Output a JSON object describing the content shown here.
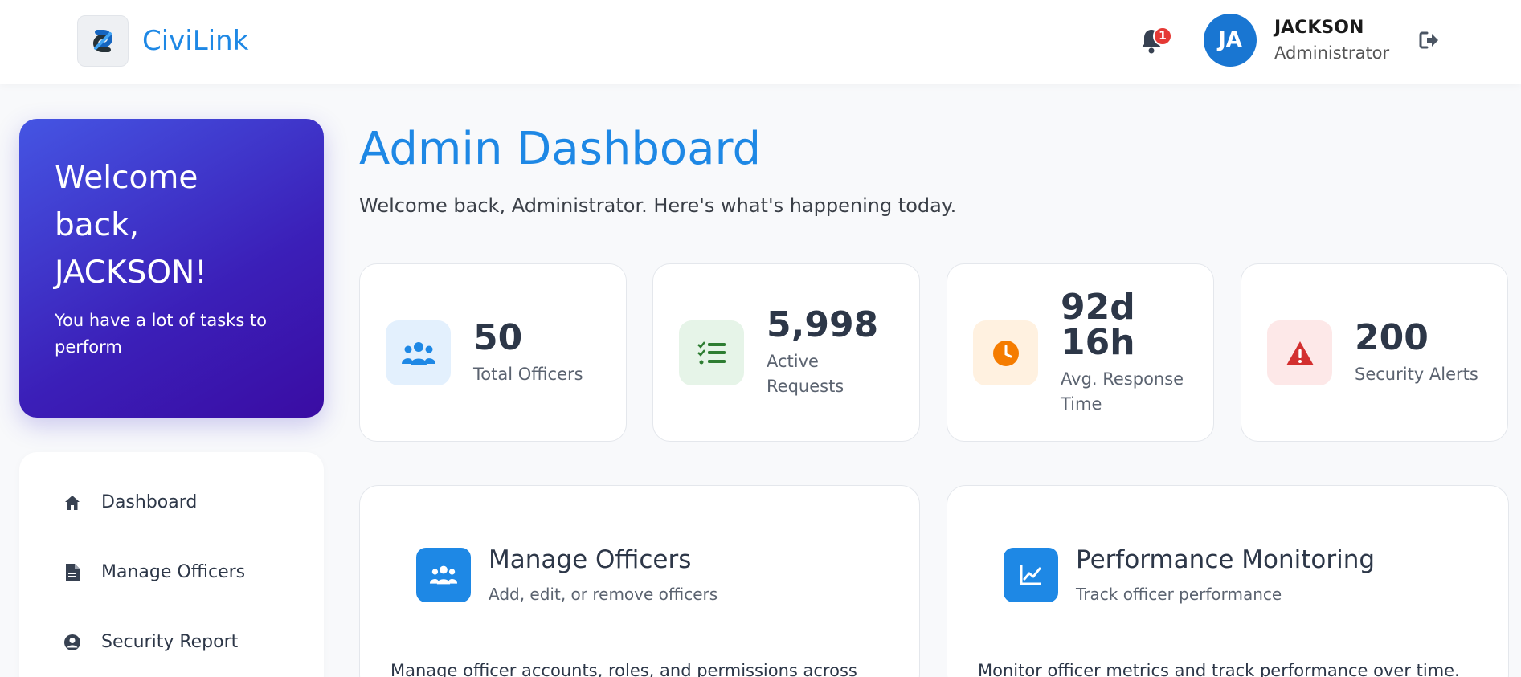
{
  "header": {
    "brand_name": "CiviLink",
    "notification_count": "1",
    "user_initials": "JA",
    "user_name": "JACKSON",
    "user_role": "Administrator"
  },
  "welcome_card": {
    "title_line1": "Welcome",
    "title_line2": "back,",
    "title_line3": "JACKSON!",
    "subtitle": "You have a lot of tasks to perform"
  },
  "sidebar": {
    "items": [
      {
        "label": "Dashboard",
        "icon": "home-icon"
      },
      {
        "label": "Manage Officers",
        "icon": "document-icon"
      },
      {
        "label": "Security Report",
        "icon": "user-circle-icon"
      }
    ]
  },
  "main": {
    "title": "Admin Dashboard",
    "subtitle": "Welcome back, Administrator. Here's what's happening today."
  },
  "stats": [
    {
      "value": "50",
      "label": "Total Officers",
      "icon": "users-icon",
      "color": "#1e88e5",
      "bg": "#e3f0fd"
    },
    {
      "value": "5,998",
      "label_line1": "Active",
      "label_line2": "Requests",
      "icon": "list-check-icon",
      "color": "#2e7d32",
      "bg": "#e6f4e8"
    },
    {
      "value_line1": "92d",
      "value_line2": "16h",
      "label_line1": "Avg. Response",
      "label_line2": "Time",
      "icon": "clock-icon",
      "color": "#f57c00",
      "bg": "#fff1e0"
    },
    {
      "value": "200",
      "label": "Security Alerts",
      "icon": "warning-icon",
      "color": "#d32f2f",
      "bg": "#fde8e8"
    }
  ],
  "features": [
    {
      "title": "Manage Officers",
      "subtitle": "Add, edit, or remove officers",
      "description": "Manage officer accounts, roles, and permissions across",
      "icon": "users-icon"
    },
    {
      "title": "Performance Monitoring",
      "subtitle": "Track officer performance",
      "description": "Monitor officer metrics and track performance over time.",
      "icon": "line-chart-icon"
    }
  ],
  "colors": {
    "accent": "#1e88e5",
    "welcome_gradient_start": "#4555e3",
    "welcome_gradient_end": "#3a0ca3",
    "badge": "#e53935"
  }
}
